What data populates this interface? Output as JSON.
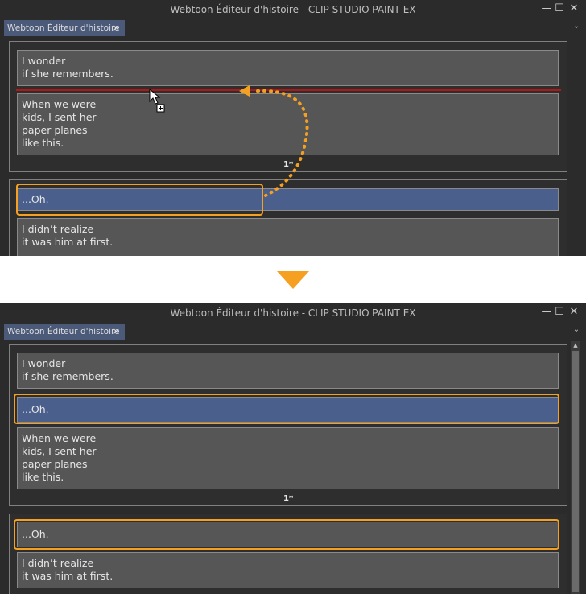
{
  "window": {
    "title": "Webtoon Éditeur d'histoire - CLIP STUDIO PAINT EX",
    "tab_label": "Webtoon Éditeur d'histoire",
    "tab_close": "×",
    "minimize": "—",
    "maximize": "☐",
    "close": "✕",
    "chevron": "⌄"
  },
  "before": {
    "page1": {
      "cells": [
        "I wonder\nif she remembers.",
        "When we were\nkids, I sent her\npaper planes\nlike this."
      ],
      "page_number": "1*"
    },
    "page2": {
      "cells": [
        "...Oh.",
        "I didn’t realize\nit was him at first."
      ]
    }
  },
  "after": {
    "page1": {
      "cells": [
        "I wonder\nif she remembers.",
        "...Oh.",
        "When we were\nkids, I sent her\npaper planes\nlike this."
      ],
      "page_number": "1*"
    },
    "page2": {
      "cells": [
        "...Oh.",
        "I didn’t realize\nit was him at first."
      ]
    }
  },
  "colors": {
    "highlight": "#f5a020",
    "selected_cell": "#4a5f8c",
    "drop_indicator": "#b01818",
    "tab_active": "#4c5a7a"
  }
}
